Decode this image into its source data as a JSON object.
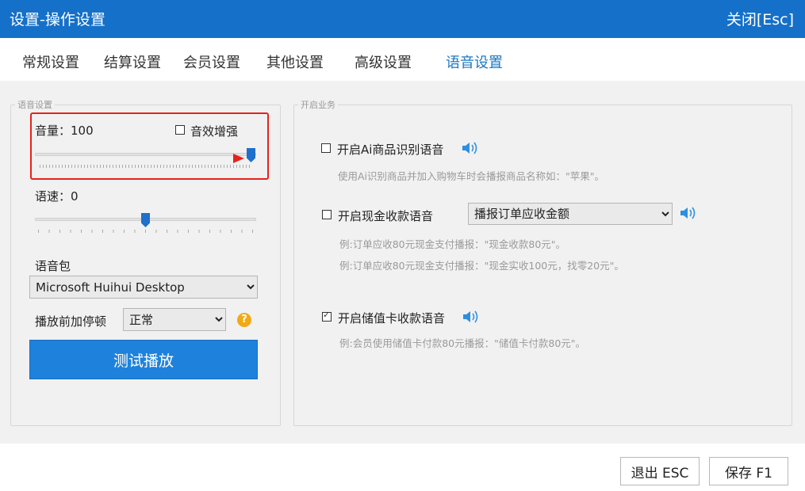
{
  "window": {
    "title": "设置-操作设置",
    "close_label": "关闭[Esc]"
  },
  "tabs": [
    {
      "label": "常规设置",
      "active": false
    },
    {
      "label": "结算设置",
      "active": false
    },
    {
      "label": "会员设置",
      "active": false
    },
    {
      "label": "其他设置",
      "active": false
    },
    {
      "label": "高级设置",
      "active": false
    },
    {
      "label": "语音设置",
      "active": true
    }
  ],
  "voice_settings": {
    "legend": "语音设置",
    "volume_label": "音量：100",
    "volume_value": 100,
    "enhance_label": "音效增强",
    "enhance_checked": false,
    "speed_label": "语速：0",
    "speed_value": 0,
    "package_label": "语音包",
    "package_value": "Microsoft Huihui Desktop",
    "pause_label": "播放前加停顿",
    "pause_value": "正常",
    "help_icon": "?",
    "test_button": "测试播放"
  },
  "business": {
    "legend": "开启业务",
    "ai": {
      "label": "开启Ai商品识别语音",
      "checked": false,
      "hint": "使用Ai识别商品并加入购物车时会播报商品名称如：\"苹果\"。"
    },
    "cash": {
      "label": "开启现金收款语音",
      "checked": false,
      "select_value": "播报订单应收金额",
      "hint1": "例:订单应收80元现金支付播报：\"现金收款80元\"。",
      "hint2": "例:订单应收80元现金支付播报：\"现金实收100元，找零20元\"。"
    },
    "stored": {
      "label": "开启储值卡收款语音",
      "checked": true,
      "hint": "例:会员使用储值卡付款80元播报：\"储值卡付款80元\"。"
    }
  },
  "footer": {
    "exit_label": "退出 ESC",
    "save_label": "保存 F1"
  },
  "colors": {
    "title_bar": "#1570c9",
    "accent": "#1a78c2",
    "primary_button": "#1e82dc",
    "highlight": "#e6221b",
    "help": "#f2a917"
  }
}
